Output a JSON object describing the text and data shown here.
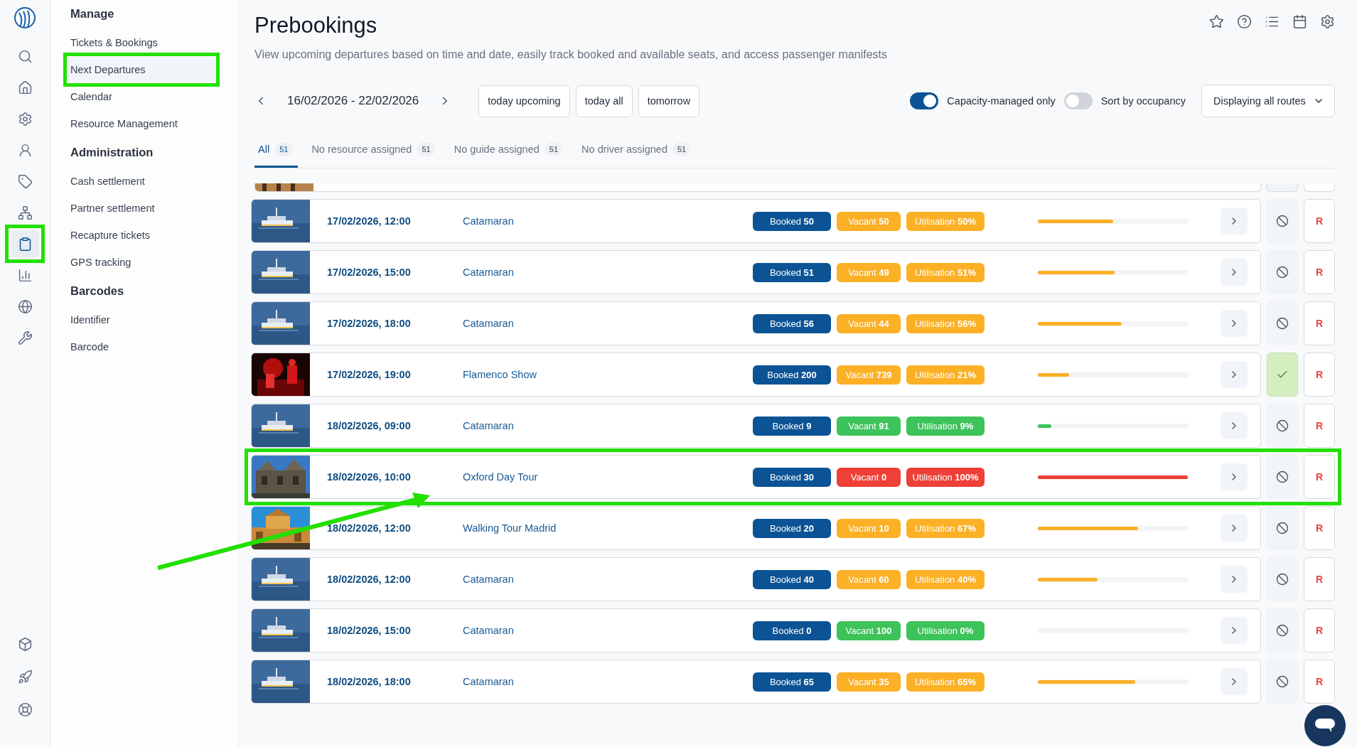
{
  "rail": {
    "top": [
      {
        "selected": false,
        "annotated": false
      },
      {
        "selected": false,
        "annotated": false
      },
      {
        "selected": false,
        "annotated": false
      },
      {
        "selected": false,
        "annotated": false
      },
      {
        "selected": false,
        "annotated": false
      },
      {
        "selected": false,
        "annotated": false
      },
      {
        "selected": true,
        "annotated": true
      },
      {
        "selected": false,
        "annotated": false
      },
      {
        "selected": false,
        "annotated": false
      },
      {
        "selected": false,
        "annotated": false
      }
    ],
    "bottom": [
      {
        "selected": false
      },
      {
        "selected": false
      },
      {
        "selected": false
      }
    ]
  },
  "nav": [
    {
      "heading": "Manage",
      "items": [
        {
          "label": "Tickets & Bookings",
          "selected": false,
          "annotated": false
        },
        {
          "label": "Next Departures",
          "selected": true,
          "annotated": true
        },
        {
          "label": "Calendar",
          "selected": false,
          "annotated": false
        },
        {
          "label": "Resource Management",
          "selected": false,
          "annotated": false
        }
      ]
    },
    {
      "heading": "Administration",
      "items": [
        {
          "label": "Cash settlement",
          "selected": false,
          "annotated": false
        },
        {
          "label": "Partner settlement",
          "selected": false,
          "annotated": false
        },
        {
          "label": "Recapture tickets",
          "selected": false,
          "annotated": false
        },
        {
          "label": "GPS tracking",
          "selected": false,
          "annotated": false
        }
      ]
    },
    {
      "heading": "Barcodes",
      "items": [
        {
          "label": "Identifier",
          "selected": false,
          "annotated": false
        },
        {
          "label": "Barcode",
          "selected": false,
          "annotated": false
        }
      ]
    }
  ],
  "page": {
    "title": "Prebookings",
    "subtitle": "View upcoming departures based on time and date, easily track booked and available seats, and access passenger manifests"
  },
  "date_range": "16/02/2026 - 22/02/2026",
  "quick_buttons": [
    "today upcoming",
    "today all",
    "tomorrow"
  ],
  "toggles": [
    {
      "label": "Capacity-managed only",
      "on": true
    },
    {
      "label": "Sort by occupancy",
      "on": false
    }
  ],
  "route_select": {
    "value": "Displaying all routes"
  },
  "tabs": [
    {
      "label": "All",
      "count": "51",
      "selected": true
    },
    {
      "label": "No resource assigned",
      "count": "51",
      "selected": false
    },
    {
      "label": "No guide assigned",
      "count": "51",
      "selected": false
    },
    {
      "label": "No driver assigned",
      "count": "51",
      "selected": false
    }
  ],
  "rows": [
    {
      "date": "17/02/2026, 12:00",
      "route": "Catamaran",
      "booked": "Booked **50**",
      "vacant": "Vacant **50**",
      "utilisation": "Utilisation **50%**",
      "color": "#fbb026",
      "level": 0.5,
      "confirmed": false,
      "annotated": false,
      "action": "R"
    },
    {
      "date": "17/02/2026, 15:00",
      "route": "Catamaran",
      "booked": "Booked **51**",
      "vacant": "Vacant **49**",
      "utilisation": "Utilisation **51%**",
      "color": "#fbb026",
      "level": 0.51,
      "confirmed": false,
      "annotated": false,
      "action": "R"
    },
    {
      "date": "17/02/2026, 18:00",
      "route": "Catamaran",
      "booked": "Booked **56**",
      "vacant": "Vacant **44**",
      "utilisation": "Utilisation **56%**",
      "color": "#fbb026",
      "level": 0.56,
      "confirmed": false,
      "annotated": false,
      "action": "R"
    },
    {
      "date": "17/02/2026, 19:00",
      "route": "Flamenco Show",
      "booked": "Booked **200**",
      "vacant": "Vacant **739**",
      "utilisation": "Utilisation **21%**",
      "color": "#fbb026",
      "level": 0.21,
      "confirmed": true,
      "annotated": false,
      "action": "R"
    },
    {
      "date": "18/02/2026, 09:00",
      "route": "Catamaran",
      "booked": "Booked **9**",
      "vacant": "Vacant **91**",
      "utilisation": "Utilisation **9%**",
      "color": "#3cc35a",
      "level": 0.09,
      "confirmed": false,
      "annotated": false,
      "action": "R"
    },
    {
      "date": "18/02/2026, 10:00",
      "route": "Oxford Day Tour",
      "booked": "Booked **30**",
      "vacant": "Vacant **0**",
      "utilisation": "Utilisation **100%**",
      "color": "#ee4036",
      "level": 1,
      "confirmed": false,
      "annotated": true,
      "action": "R"
    },
    {
      "date": "18/02/2026, 12:00",
      "route": "Walking Tour Madrid",
      "booked": "Booked **20**",
      "vacant": "Vacant **10**",
      "utilisation": "Utilisation **67%**",
      "color": "#fbb026",
      "level": 0.67,
      "confirmed": false,
      "annotated": false,
      "action": "R"
    },
    {
      "date": "18/02/2026, 12:00",
      "route": "Catamaran",
      "booked": "Booked **40**",
      "vacant": "Vacant **60**",
      "utilisation": "Utilisation **40%**",
      "color": "#fbb026",
      "level": 0.4,
      "confirmed": false,
      "annotated": false,
      "action": "R"
    },
    {
      "date": "18/02/2026, 15:00",
      "route": "Catamaran",
      "booked": "Booked **0**",
      "vacant": "Vacant **100**",
      "utilisation": "Utilisation **0%**",
      "color": "#3cc35a",
      "level": 0,
      "confirmed": false,
      "annotated": false,
      "action": "R"
    },
    {
      "date": "18/02/2026, 18:00",
      "route": "Catamaran",
      "booked": "Booked **65**",
      "vacant": "Vacant **35**",
      "utilisation": "Utilisation **65%**",
      "color": "#fbb026",
      "level": 0.65,
      "confirmed": false,
      "annotated": false,
      "action": "R"
    }
  ],
  "annotations": [
    {
      "kind": "arrow"
    }
  ]
}
